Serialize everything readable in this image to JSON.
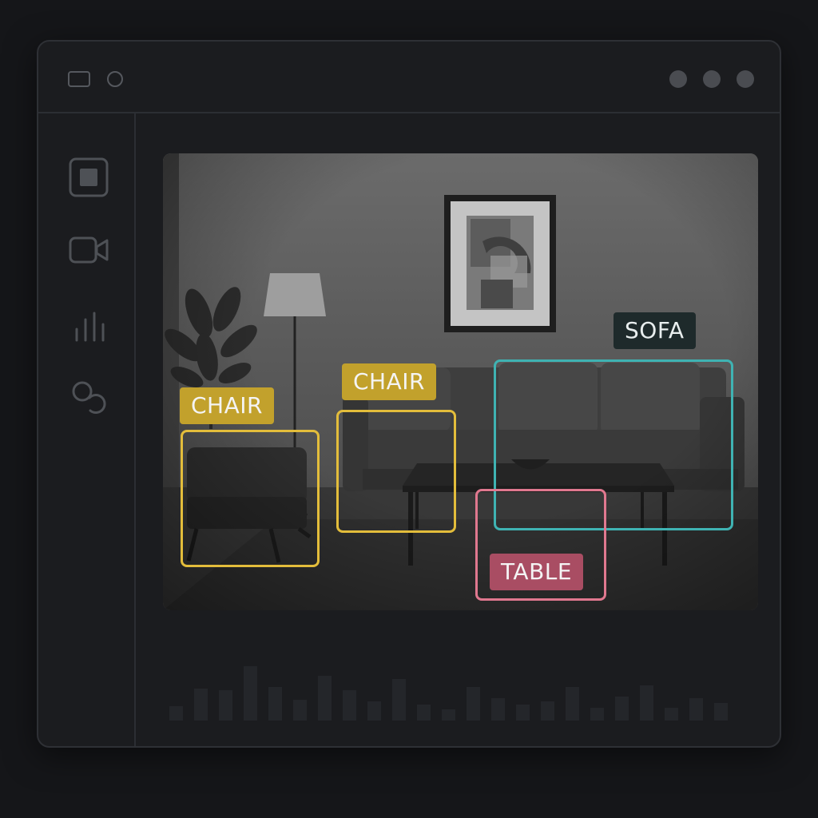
{
  "titlebar": {
    "left_icons": [
      "window-icon",
      "record-icon"
    ],
    "right_icons": [
      "window-dot-icon",
      "window-dot-icon",
      "window-dot-icon"
    ]
  },
  "sidebar": {
    "items": [
      {
        "icon": "stop-square-icon"
      },
      {
        "icon": "video-camera-icon"
      },
      {
        "icon": "bar-chart-icon"
      },
      {
        "icon": "link-icon"
      }
    ]
  },
  "detections": [
    {
      "label": "CHAIR",
      "color": "#e3bd3b"
    },
    {
      "label": "CHAIR",
      "color": "#e3bd3b"
    },
    {
      "label": "SOFA",
      "color": "#3fb3b3"
    },
    {
      "label": "TABLE",
      "color": "#e0788f"
    }
  ],
  "colors": {
    "chair": "#e3bd3b",
    "sofa": "#3fb3b3",
    "table": "#e0788f",
    "background": "#151619"
  }
}
